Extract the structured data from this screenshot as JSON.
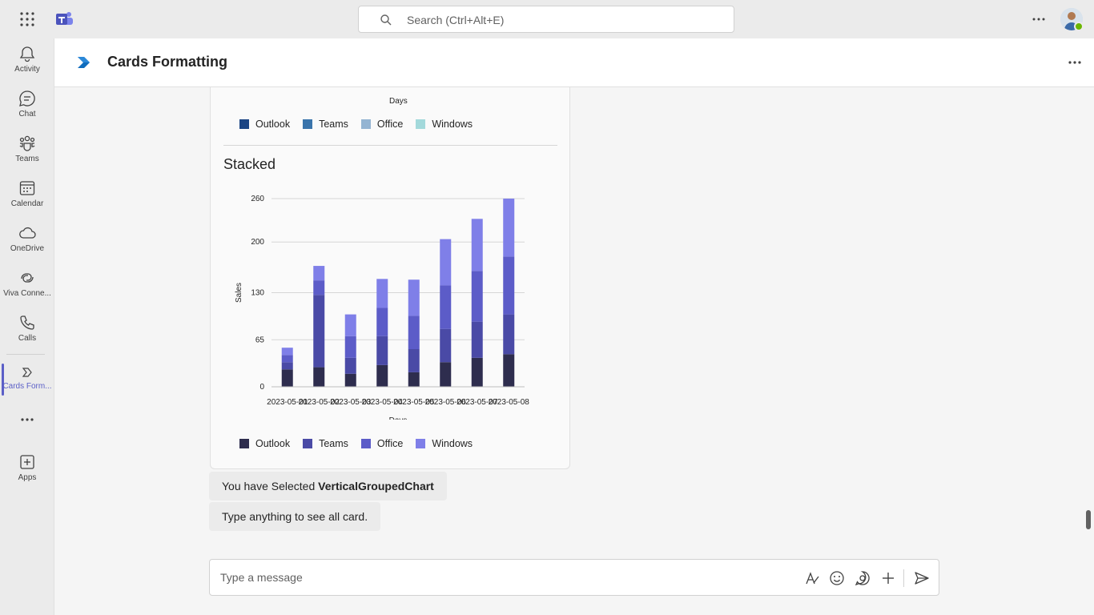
{
  "topbar": {
    "search_placeholder": "Search (Ctrl+Alt+E)",
    "icons": [
      "waffle-icon",
      "teams-logo-icon",
      "search-icon",
      "more-icon",
      "avatar"
    ]
  },
  "rail": {
    "items": [
      {
        "label": "Activity",
        "icon": "bell-icon"
      },
      {
        "label": "Chat",
        "icon": "chat-icon"
      },
      {
        "label": "Teams",
        "icon": "teams-icon"
      },
      {
        "label": "Calendar",
        "icon": "calendar-icon"
      },
      {
        "label": "OneDrive",
        "icon": "cloud-icon"
      },
      {
        "label": "Viva Conne...",
        "icon": "viva-connections-icon"
      },
      {
        "label": "Calls",
        "icon": "phone-icon"
      },
      {
        "label": "Cards Form...",
        "icon": "cards-formatting-icon"
      },
      {
        "label": "Apps",
        "icon": "add-apps-icon"
      }
    ],
    "active": "Cards Form..."
  },
  "app_header": {
    "title": "Cards Formatting"
  },
  "card": {
    "top_legend": {
      "axis_title": "Days",
      "entries": [
        {
          "name": "Outlook",
          "color": "#1b4584"
        },
        {
          "name": "Teams",
          "color": "#3a74ab"
        },
        {
          "name": "Office",
          "color": "#94b4d2"
        },
        {
          "name": "Windows",
          "color": "#a3d9db"
        }
      ]
    },
    "heading": "Stacked"
  },
  "chart_data": {
    "type": "bar",
    "stacked": true,
    "title": "Stacked",
    "xlabel": "Days",
    "ylabel": "Sales",
    "categories": [
      "2023-05-01",
      "2023-05-02",
      "2023-05-03",
      "2023-05-04",
      "2023-05-05",
      "2023-05-06",
      "2023-05-07",
      "2023-05-08"
    ],
    "yticks": [
      0,
      65,
      130,
      200,
      260
    ],
    "ylim": [
      0,
      260
    ],
    "grid": true,
    "legend_position": "bottom",
    "series": [
      {
        "name": "Outlook",
        "color": "#2e2d4e",
        "values": [
          24,
          27,
          18,
          30,
          20,
          34,
          40,
          45
        ]
      },
      {
        "name": "Teams",
        "color": "#4a4aa6",
        "values": [
          10,
          100,
          22,
          40,
          32,
          46,
          50,
          55
        ]
      },
      {
        "name": "Office",
        "color": "#5c5cc8",
        "values": [
          10,
          20,
          30,
          39,
          46,
          60,
          70,
          80
        ]
      },
      {
        "name": "Windows",
        "color": "#7f7fe8",
        "values": [
          10,
          20,
          30,
          40,
          50,
          64,
          72,
          80
        ]
      }
    ]
  },
  "messages": [
    {
      "prefix": "You have Selected ",
      "bold": "VerticalGroupedChart"
    },
    {
      "text": "Type anything to see all card."
    }
  ],
  "composer": {
    "placeholder": "Type a message",
    "icons": [
      "format-icon",
      "emoji-icon",
      "loop-icon",
      "attach-plus-icon",
      "send-icon"
    ]
  }
}
